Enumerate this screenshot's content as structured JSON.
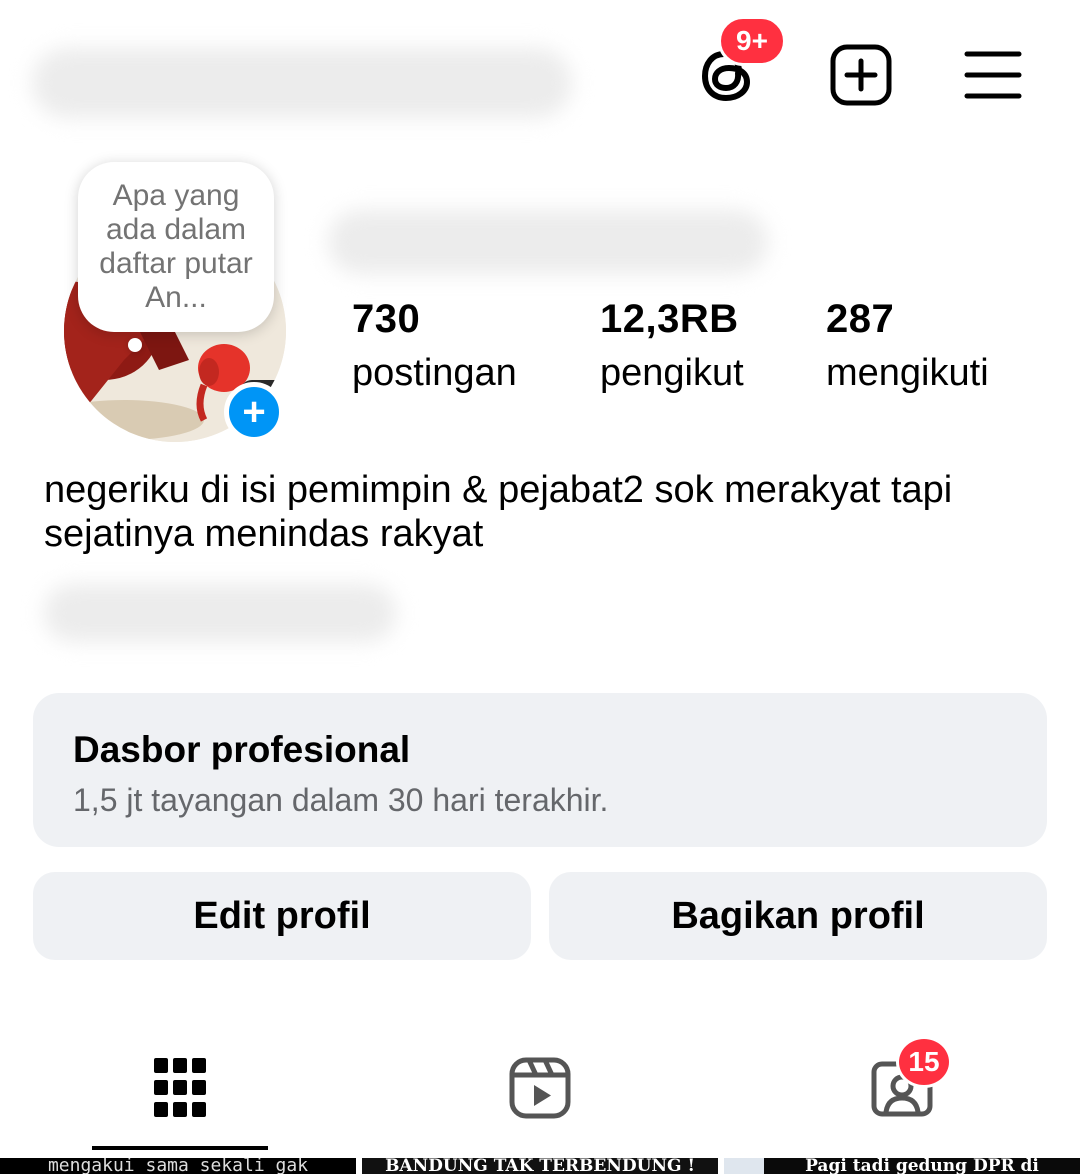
{
  "header": {
    "threads_badge": "9+"
  },
  "note": {
    "text": "Apa yang ada dalam daftar putar An..."
  },
  "stats": {
    "posts": {
      "value": "730",
      "label": "postingan"
    },
    "followers": {
      "value": "12,3RB",
      "label": "pengikut"
    },
    "following": {
      "value": "287",
      "label": "mengikuti"
    }
  },
  "bio": "negeriku di isi pemimpin & pejabat2 sok merakyat tapi sejatinya menindas rakyat",
  "dashboard": {
    "title": "Dasbor profesional",
    "subtitle": "1,5 jt tayangan dalam 30 hari terakhir."
  },
  "buttons": {
    "edit": "Edit profil",
    "share": "Bagikan profil"
  },
  "tabs": {
    "tagged_badge": "15"
  },
  "thumbnails": [
    "mengakui sama sekali gak",
    "BANDUNG TAK TERBENDUNG !",
    "Pagi tadi gedung DPR di"
  ],
  "colors": {
    "accent_blue": "#0095f6",
    "badge_red": "#ff3040",
    "card_bg": "#eff1f4",
    "muted_text": "#65676b"
  }
}
